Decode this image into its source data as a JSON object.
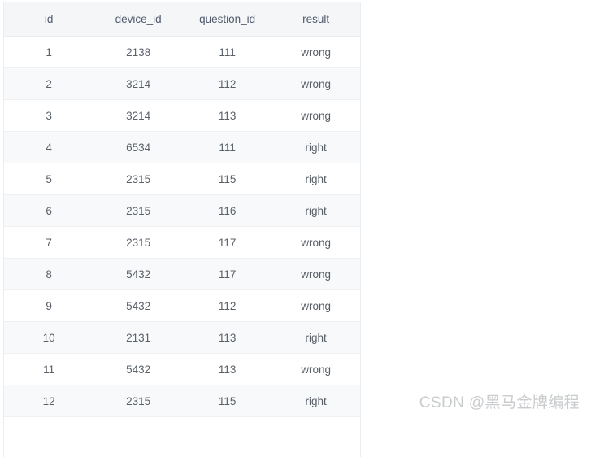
{
  "table": {
    "columns": [
      {
        "key": "id",
        "label": "id"
      },
      {
        "key": "device_id",
        "label": "device_id"
      },
      {
        "key": "question_id",
        "label": "question_id"
      },
      {
        "key": "result",
        "label": "result"
      }
    ],
    "rows": [
      {
        "id": "1",
        "device_id": "2138",
        "question_id": "111",
        "result": "wrong"
      },
      {
        "id": "2",
        "device_id": "3214",
        "question_id": "112",
        "result": "wrong"
      },
      {
        "id": "3",
        "device_id": "3214",
        "question_id": "113",
        "result": "wrong"
      },
      {
        "id": "4",
        "device_id": "6534",
        "question_id": "111",
        "result": "right"
      },
      {
        "id": "5",
        "device_id": "2315",
        "question_id": "115",
        "result": "right"
      },
      {
        "id": "6",
        "device_id": "2315",
        "question_id": "116",
        "result": "right"
      },
      {
        "id": "7",
        "device_id": "2315",
        "question_id": "117",
        "result": "wrong"
      },
      {
        "id": "8",
        "device_id": "5432",
        "question_id": "117",
        "result": "wrong"
      },
      {
        "id": "9",
        "device_id": "5432",
        "question_id": "112",
        "result": "wrong"
      },
      {
        "id": "10",
        "device_id": "2131",
        "question_id": "113",
        "result": "right"
      },
      {
        "id": "11",
        "device_id": "5432",
        "question_id": "113",
        "result": "wrong"
      },
      {
        "id": "12",
        "device_id": "2315",
        "question_id": "115",
        "result": "right"
      }
    ]
  },
  "watermark": {
    "text": "CSDN @黑马金牌编程"
  },
  "colors": {
    "header_background": "#f5f6f7",
    "header_text": "#515a6e",
    "cell_text": "#5a6068",
    "row_odd_background": "#ffffff",
    "row_even_background": "#f8f9fa",
    "row_border": "#eef0f2",
    "panel_border": "#ebeef1",
    "watermark_text": "#c9cbcd"
  }
}
